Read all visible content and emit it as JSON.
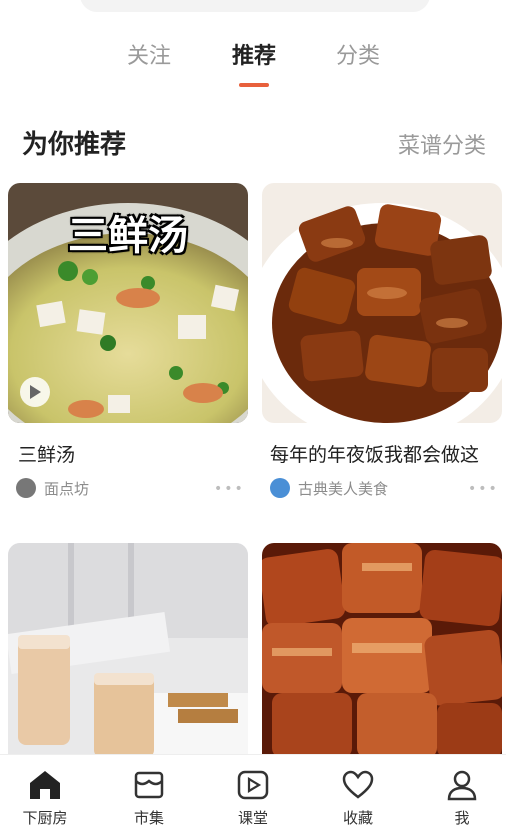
{
  "tabs": [
    {
      "label": "关注"
    },
    {
      "label": "推荐",
      "active": true
    },
    {
      "label": "分类"
    }
  ],
  "section": {
    "title": "为你推荐",
    "link": "菜谱分类"
  },
  "cards": [
    {
      "title": "三鲜汤",
      "overlay": "三鲜汤",
      "author": "面点坊",
      "has_video": true
    },
    {
      "title": "每年的年夜饭我都会做这",
      "author": "古典美人美食"
    },
    {
      "title": "",
      "author": ""
    },
    {
      "title": "",
      "author": ""
    }
  ],
  "more_label": "•••",
  "nav": [
    {
      "label": "下厨房",
      "icon": "home-icon",
      "active": true
    },
    {
      "label": "市集",
      "icon": "market-icon"
    },
    {
      "label": "课堂",
      "icon": "play-icon"
    },
    {
      "label": "收藏",
      "icon": "heart-icon"
    },
    {
      "label": "我",
      "icon": "person-icon"
    }
  ],
  "colors": {
    "accent": "#e8603c",
    "text": "#222222",
    "muted": "#9a9a9a"
  }
}
